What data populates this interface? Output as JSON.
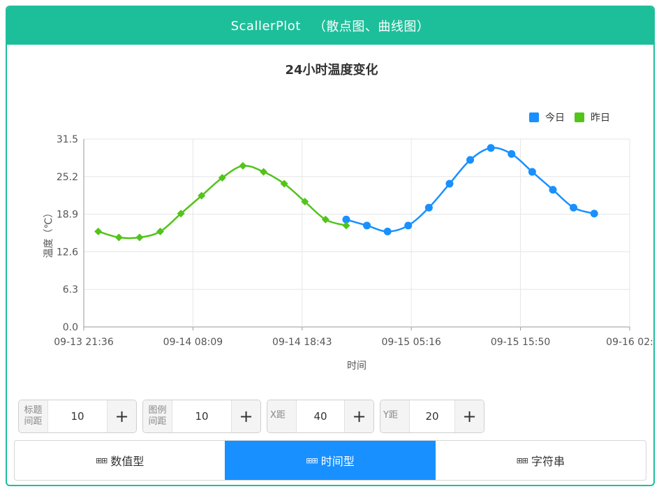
{
  "header": {
    "app_name": "ScallerPlot",
    "subtitle": "（散点图、曲线图）"
  },
  "colors": {
    "accent": "#1dbf9a",
    "today": "#1890ff",
    "yesterday": "#52c41a",
    "tab_active": "#1890ff"
  },
  "chart_data": {
    "type": "line",
    "title": "24小时温度变化",
    "xlabel": "时间",
    "ylabel": "温度（℃）",
    "ylim": [
      0,
      31.5
    ],
    "y_ticks": [
      "0.0",
      "6.3",
      "12.6",
      "18.9",
      "25.2",
      "31.5"
    ],
    "x_ticks": [
      "09-13 21:36",
      "09-14 08:09",
      "09-14 18:43",
      "09-15 05:16",
      "09-15 15:50",
      "09-16 02:"
    ],
    "grid": true,
    "legend_position": "top-right",
    "series": [
      {
        "name": "今日",
        "color": "#1890ff",
        "marker": "circle",
        "x": [
          "09-14 23:00",
          "09-15 01:00",
          "09-15 03:00",
          "09-15 05:00",
          "09-15 07:00",
          "09-15 09:00",
          "09-15 11:00",
          "09-15 13:00",
          "09-15 15:00",
          "09-15 17:00",
          "09-15 19:00",
          "09-15 21:00",
          "09-15 23:00"
        ],
        "y": [
          18.0,
          17.0,
          16.0,
          17.0,
          20.0,
          24.0,
          28.0,
          30.0,
          29.0,
          26.0,
          23.0,
          20.0,
          19.0
        ]
      },
      {
        "name": "昨日",
        "color": "#52c41a",
        "marker": "diamond",
        "x": [
          "09-13 23:00",
          "09-14 01:00",
          "09-14 03:00",
          "09-14 05:00",
          "09-14 07:00",
          "09-14 09:00",
          "09-14 11:00",
          "09-14 13:00",
          "09-14 15:00",
          "09-14 17:00",
          "09-14 19:00",
          "09-14 21:00",
          "09-14 23:00"
        ],
        "y": [
          16.0,
          15.0,
          15.0,
          16.0,
          19.0,
          22.0,
          25.0,
          27.0,
          26.0,
          24.0,
          21.0,
          18.0,
          17.0
        ]
      }
    ]
  },
  "controls": [
    {
      "label": "标题间距",
      "label_lines": [
        "标题",
        "间距"
      ],
      "value": "10"
    },
    {
      "label": "图例间距",
      "label_lines": [
        "图例",
        "间距"
      ],
      "value": "10"
    },
    {
      "label": "X距",
      "label_lines": [
        "X距"
      ],
      "value": "40"
    },
    {
      "label": "Y距",
      "label_lines": [
        "Y距"
      ],
      "value": "20"
    }
  ],
  "plus_symbol": "+",
  "tabs": [
    {
      "label": "数值型",
      "icon": "grid-icon",
      "active": false
    },
    {
      "label": "时间型",
      "icon": "grid-icon",
      "active": true
    },
    {
      "label": "字符串",
      "icon": "grid-icon",
      "active": false
    }
  ]
}
